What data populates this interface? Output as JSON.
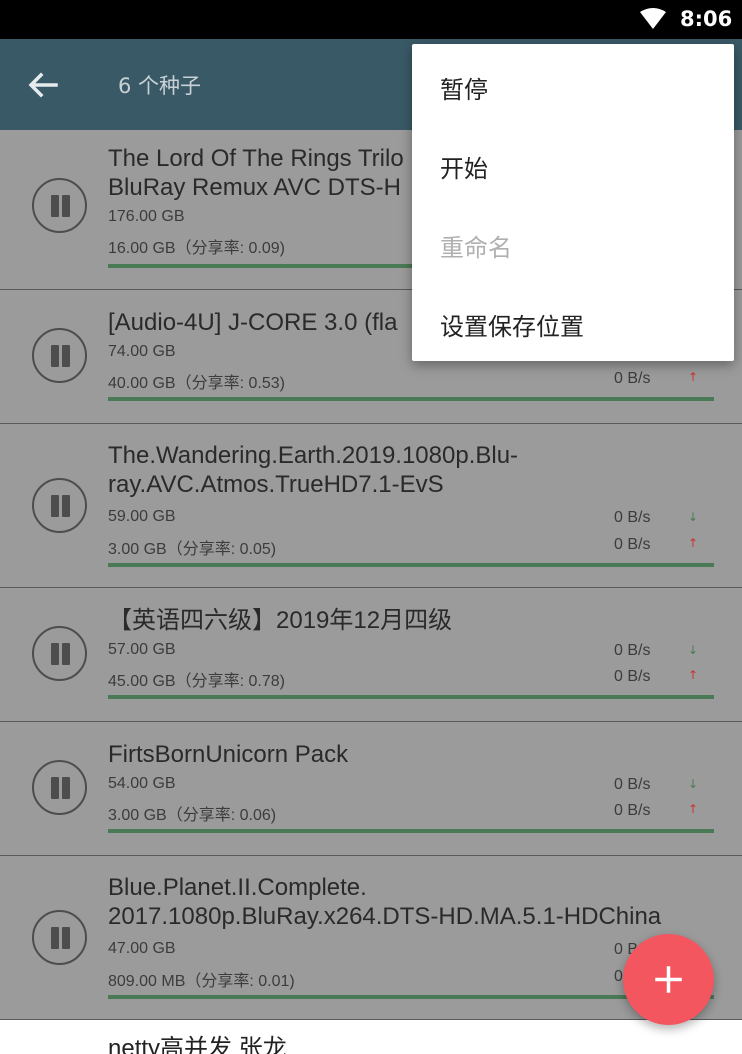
{
  "status_bar": {
    "time": "8:06"
  },
  "app_bar": {
    "title": "6 个种子"
  },
  "torrents": [
    {
      "name_line1": "The Lord Of The Rings Trilo",
      "name_line2": "BluRay Remux AVC DTS-H",
      "size": "176.00 GB",
      "uploaded": "16.00 GB（分享率: 0.09)",
      "download_speed": "",
      "upload_speed": ""
    },
    {
      "name_line1": "[Audio-4U] J-CORE 3.0 (fla",
      "size": "74.00 GB",
      "uploaded": "40.00 GB（分享率: 0.53)",
      "upload_speed": "0 B/s"
    },
    {
      "name_line1": "The.Wandering.Earth.2019.1080p.Blu-",
      "name_line2": "ray.AVC.Atmos.TrueHD7.1-EvS",
      "size": "59.00 GB",
      "uploaded": "3.00 GB（分享率: 0.05)",
      "download_speed": "0 B/s",
      "upload_speed": "0 B/s"
    },
    {
      "name_line1": "【英语四六级】2019年12月四级",
      "size": "57.00 GB",
      "uploaded": "45.00 GB（分享率: 0.78)",
      "download_speed": "0 B/s",
      "upload_speed": "0 B/s"
    },
    {
      "name_line1": "FirtsBornUnicorn Pack",
      "size": "54.00 GB",
      "uploaded": "3.00 GB（分享率: 0.06)",
      "download_speed": "0 B/s",
      "upload_speed": "0 B/s"
    },
    {
      "name_line1": "Blue.Planet.II.Complete.",
      "name_line2": "2017.1080p.BluRay.x264.DTS-HD.MA.5.1-HDChina",
      "size": "47.00 GB",
      "uploaded": "809.00 MB（分享率: 0.01)",
      "download_speed": "0 B/s",
      "upload_speed": "0 B/s"
    }
  ],
  "peek_item": {
    "name": "netty高并发 张龙"
  },
  "menu": {
    "items": [
      {
        "label": "暂停",
        "enabled": true
      },
      {
        "label": "开始",
        "enabled": true
      },
      {
        "label": "重命名",
        "enabled": false
      },
      {
        "label": "设置保存位置",
        "enabled": true
      }
    ]
  },
  "arrows": {
    "down": "↓",
    "up": "↑"
  },
  "fab": {
    "icon": "plus-icon"
  },
  "colors": {
    "app_bar": "#3a5966",
    "fab": "#f45660",
    "progress": "#4a7a55"
  }
}
